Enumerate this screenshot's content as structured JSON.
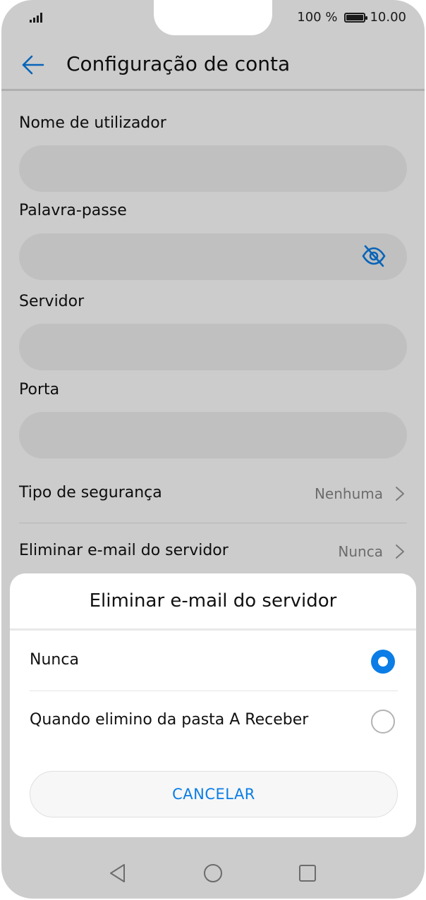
{
  "status_bar": {
    "battery_percent": "100 %",
    "time": "10.00",
    "signal_icon": "signal-icon",
    "battery_icon": "battery-icon"
  },
  "toolbar": {
    "back_icon": "back-arrow-icon",
    "title": "Configuração de conta"
  },
  "form": {
    "username": {
      "label": "Nome de utilizador",
      "value": ""
    },
    "password": {
      "label": "Palavra-passe",
      "value": "",
      "visibility_icon": "eye-hidden-icon"
    },
    "server": {
      "label": "Servidor",
      "value": ""
    },
    "port": {
      "label": "Porta",
      "value": ""
    }
  },
  "settings": {
    "security": {
      "label": "Tipo de segurança",
      "value": "Nenhuma"
    },
    "delete_from_server": {
      "label": "Eliminar e-mail do servidor",
      "value": "Nunca"
    }
  },
  "dialog": {
    "title": "Eliminar e-mail do servidor",
    "options": [
      {
        "label": "Nunca",
        "selected": true
      },
      {
        "label": "Quando elimino da pasta A Receber",
        "selected": false
      }
    ],
    "cancel_label": "CANCELAR"
  },
  "nav_bar": {
    "back_icon": "nav-back-icon",
    "home_icon": "nav-home-icon",
    "recents_icon": "nav-recents-icon"
  },
  "colors": {
    "accent": "#0a7de6",
    "overlay": "rgba(0,0,0,0.20)"
  }
}
